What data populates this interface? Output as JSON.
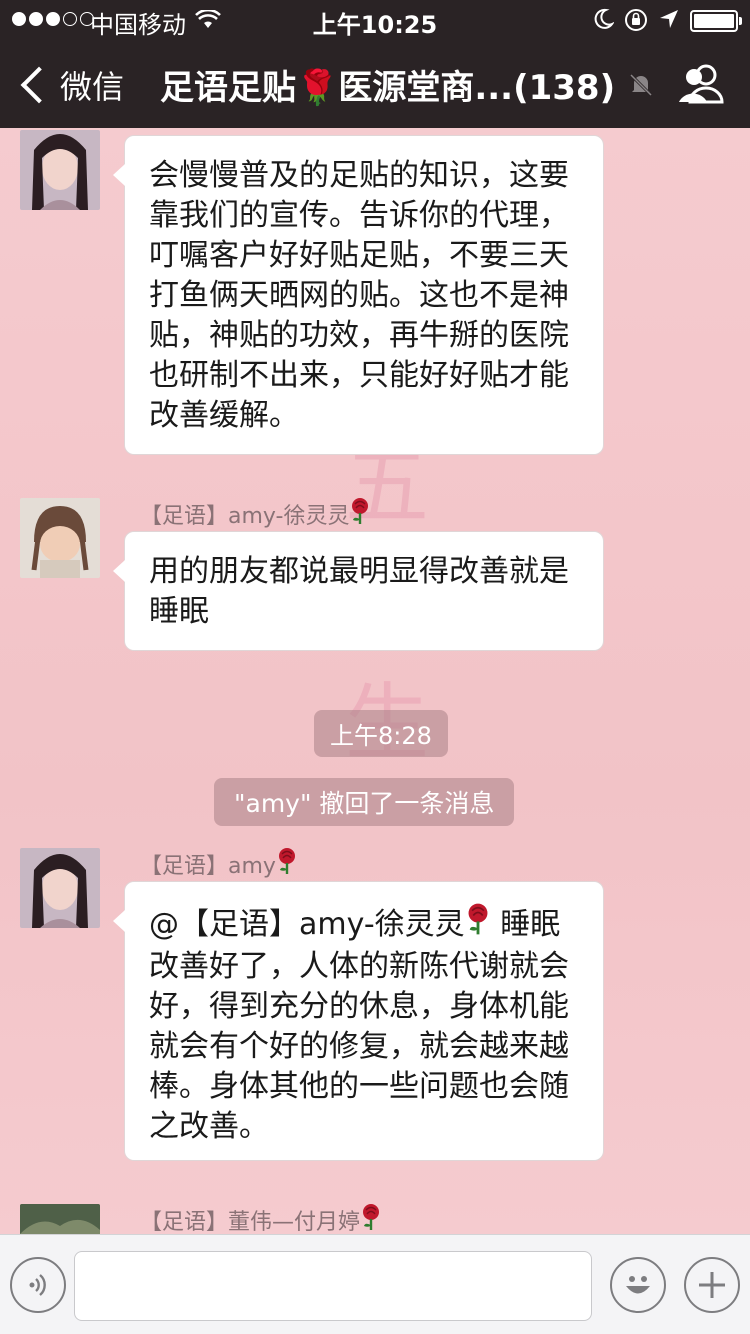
{
  "status_bar": {
    "carrier": "中国移动",
    "time": "上午10:25"
  },
  "nav": {
    "back_label": "微信",
    "title": "足语足贴🌹医源堂商...(138)"
  },
  "watermark": "五 养 生",
  "messages": [
    {
      "sender": "",
      "text": "会慢慢普及的足贴的知识，这要靠我们的宣传。告诉你的代理，叮嘱客户好好贴足贴，不要三天打鱼俩天晒网的贴。这也不是神贴，神贴的功效，再牛掰的医院也研制不出来，只能好好贴才能改善缓解。"
    },
    {
      "sender": "【足语】amy-徐灵灵",
      "text": "用的朋友都说最明显得改善就是睡眠"
    },
    {
      "sender": "【足语】amy",
      "text_prefix": "@【足语】amy-徐灵灵",
      "text": " 睡眠改善好了，人体的新陈代谢就会好，得到充分的休息，身体机能就会有个好的修复，就会越来越棒。身体其他的一些问题也会随之改善。"
    },
    {
      "sender": "【足语】董伟—付月婷",
      "text": ""
    }
  ],
  "system": {
    "timestamp": "上午8:28",
    "recall_notice": "\"amy\" 撤回了一条消息"
  },
  "colors": {
    "chat_background": "#f3c6c9",
    "topbar": "#2a2325",
    "bubble": "#ffffff",
    "rose": "#c0182c"
  }
}
